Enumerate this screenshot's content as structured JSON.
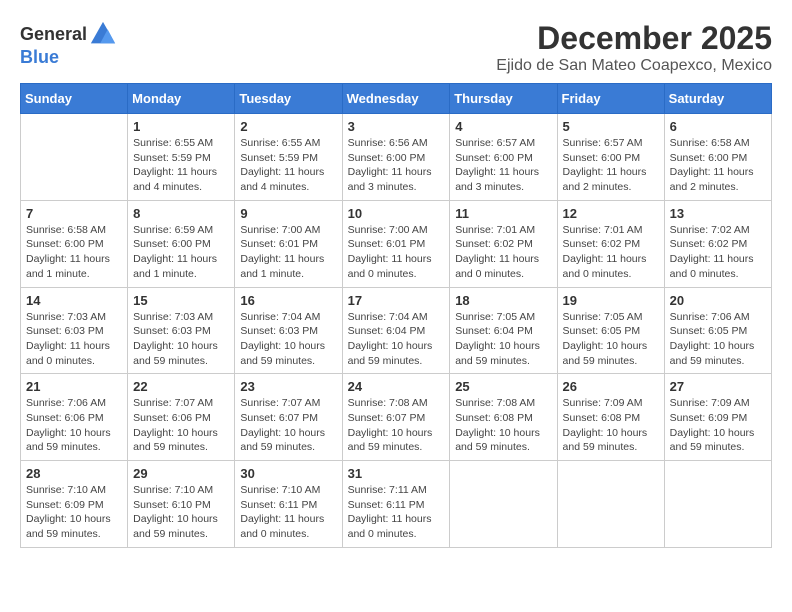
{
  "logo": {
    "general": "General",
    "blue": "Blue"
  },
  "title": "December 2025",
  "subtitle": "Ejido de San Mateo Coapexco, Mexico",
  "headers": [
    "Sunday",
    "Monday",
    "Tuesday",
    "Wednesday",
    "Thursday",
    "Friday",
    "Saturday"
  ],
  "weeks": [
    [
      {
        "day": "",
        "info": ""
      },
      {
        "day": "1",
        "info": "Sunrise: 6:55 AM\nSunset: 5:59 PM\nDaylight: 11 hours\nand 4 minutes."
      },
      {
        "day": "2",
        "info": "Sunrise: 6:55 AM\nSunset: 5:59 PM\nDaylight: 11 hours\nand 4 minutes."
      },
      {
        "day": "3",
        "info": "Sunrise: 6:56 AM\nSunset: 6:00 PM\nDaylight: 11 hours\nand 3 minutes."
      },
      {
        "day": "4",
        "info": "Sunrise: 6:57 AM\nSunset: 6:00 PM\nDaylight: 11 hours\nand 3 minutes."
      },
      {
        "day": "5",
        "info": "Sunrise: 6:57 AM\nSunset: 6:00 PM\nDaylight: 11 hours\nand 2 minutes."
      },
      {
        "day": "6",
        "info": "Sunrise: 6:58 AM\nSunset: 6:00 PM\nDaylight: 11 hours\nand 2 minutes."
      }
    ],
    [
      {
        "day": "7",
        "info": "Sunrise: 6:58 AM\nSunset: 6:00 PM\nDaylight: 11 hours\nand 1 minute."
      },
      {
        "day": "8",
        "info": "Sunrise: 6:59 AM\nSunset: 6:00 PM\nDaylight: 11 hours\nand 1 minute."
      },
      {
        "day": "9",
        "info": "Sunrise: 7:00 AM\nSunset: 6:01 PM\nDaylight: 11 hours\nand 1 minute."
      },
      {
        "day": "10",
        "info": "Sunrise: 7:00 AM\nSunset: 6:01 PM\nDaylight: 11 hours\nand 0 minutes."
      },
      {
        "day": "11",
        "info": "Sunrise: 7:01 AM\nSunset: 6:02 PM\nDaylight: 11 hours\nand 0 minutes."
      },
      {
        "day": "12",
        "info": "Sunrise: 7:01 AM\nSunset: 6:02 PM\nDaylight: 11 hours\nand 0 minutes."
      },
      {
        "day": "13",
        "info": "Sunrise: 7:02 AM\nSunset: 6:02 PM\nDaylight: 11 hours\nand 0 minutes."
      }
    ],
    [
      {
        "day": "14",
        "info": "Sunrise: 7:03 AM\nSunset: 6:03 PM\nDaylight: 11 hours\nand 0 minutes."
      },
      {
        "day": "15",
        "info": "Sunrise: 7:03 AM\nSunset: 6:03 PM\nDaylight: 10 hours\nand 59 minutes."
      },
      {
        "day": "16",
        "info": "Sunrise: 7:04 AM\nSunset: 6:03 PM\nDaylight: 10 hours\nand 59 minutes."
      },
      {
        "day": "17",
        "info": "Sunrise: 7:04 AM\nSunset: 6:04 PM\nDaylight: 10 hours\nand 59 minutes."
      },
      {
        "day": "18",
        "info": "Sunrise: 7:05 AM\nSunset: 6:04 PM\nDaylight: 10 hours\nand 59 minutes."
      },
      {
        "day": "19",
        "info": "Sunrise: 7:05 AM\nSunset: 6:05 PM\nDaylight: 10 hours\nand 59 minutes."
      },
      {
        "day": "20",
        "info": "Sunrise: 7:06 AM\nSunset: 6:05 PM\nDaylight: 10 hours\nand 59 minutes."
      }
    ],
    [
      {
        "day": "21",
        "info": "Sunrise: 7:06 AM\nSunset: 6:06 PM\nDaylight: 10 hours\nand 59 minutes."
      },
      {
        "day": "22",
        "info": "Sunrise: 7:07 AM\nSunset: 6:06 PM\nDaylight: 10 hours\nand 59 minutes."
      },
      {
        "day": "23",
        "info": "Sunrise: 7:07 AM\nSunset: 6:07 PM\nDaylight: 10 hours\nand 59 minutes."
      },
      {
        "day": "24",
        "info": "Sunrise: 7:08 AM\nSunset: 6:07 PM\nDaylight: 10 hours\nand 59 minutes."
      },
      {
        "day": "25",
        "info": "Sunrise: 7:08 AM\nSunset: 6:08 PM\nDaylight: 10 hours\nand 59 minutes."
      },
      {
        "day": "26",
        "info": "Sunrise: 7:09 AM\nSunset: 6:08 PM\nDaylight: 10 hours\nand 59 minutes."
      },
      {
        "day": "27",
        "info": "Sunrise: 7:09 AM\nSunset: 6:09 PM\nDaylight: 10 hours\nand 59 minutes."
      }
    ],
    [
      {
        "day": "28",
        "info": "Sunrise: 7:10 AM\nSunset: 6:09 PM\nDaylight: 10 hours\nand 59 minutes."
      },
      {
        "day": "29",
        "info": "Sunrise: 7:10 AM\nSunset: 6:10 PM\nDaylight: 10 hours\nand 59 minutes."
      },
      {
        "day": "30",
        "info": "Sunrise: 7:10 AM\nSunset: 6:11 PM\nDaylight: 11 hours\nand 0 minutes."
      },
      {
        "day": "31",
        "info": "Sunrise: 7:11 AM\nSunset: 6:11 PM\nDaylight: 11 hours\nand 0 minutes."
      },
      {
        "day": "",
        "info": ""
      },
      {
        "day": "",
        "info": ""
      },
      {
        "day": "",
        "info": ""
      }
    ]
  ]
}
